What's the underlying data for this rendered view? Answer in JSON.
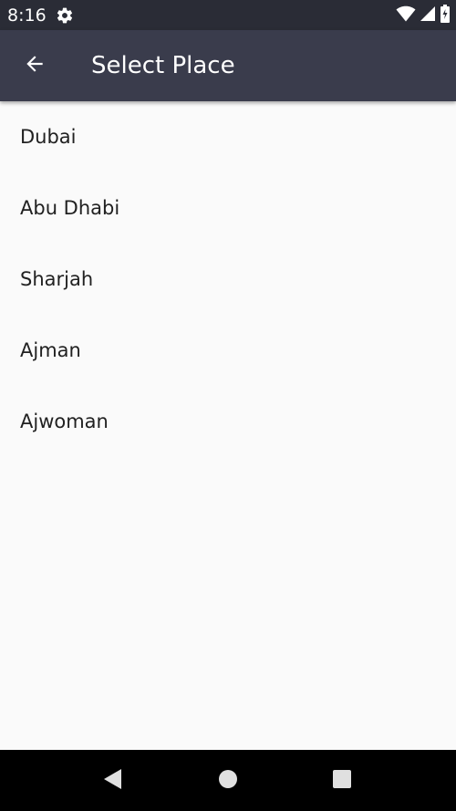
{
  "status_bar": {
    "time": "8:16",
    "icons": [
      "gear-icon",
      "wifi-icon",
      "cell-signal-icon",
      "battery-icon"
    ]
  },
  "app_bar": {
    "title": "Select Place",
    "back_icon": "back-arrow-icon"
  },
  "places": [
    {
      "label": "Dubai"
    },
    {
      "label": "Abu Dhabi"
    },
    {
      "label": "Sharjah"
    },
    {
      "label": "Ajman"
    },
    {
      "label": "Ajwoman"
    }
  ],
  "nav_bar": {
    "icons": [
      "nav-back-icon",
      "nav-home-icon",
      "nav-recents-icon"
    ]
  },
  "colors": {
    "status_bar": "#2a2c36",
    "app_bar": "#3a3c4c",
    "background": "#fafafa",
    "text": "#212121",
    "nav_bar": "#000000"
  }
}
